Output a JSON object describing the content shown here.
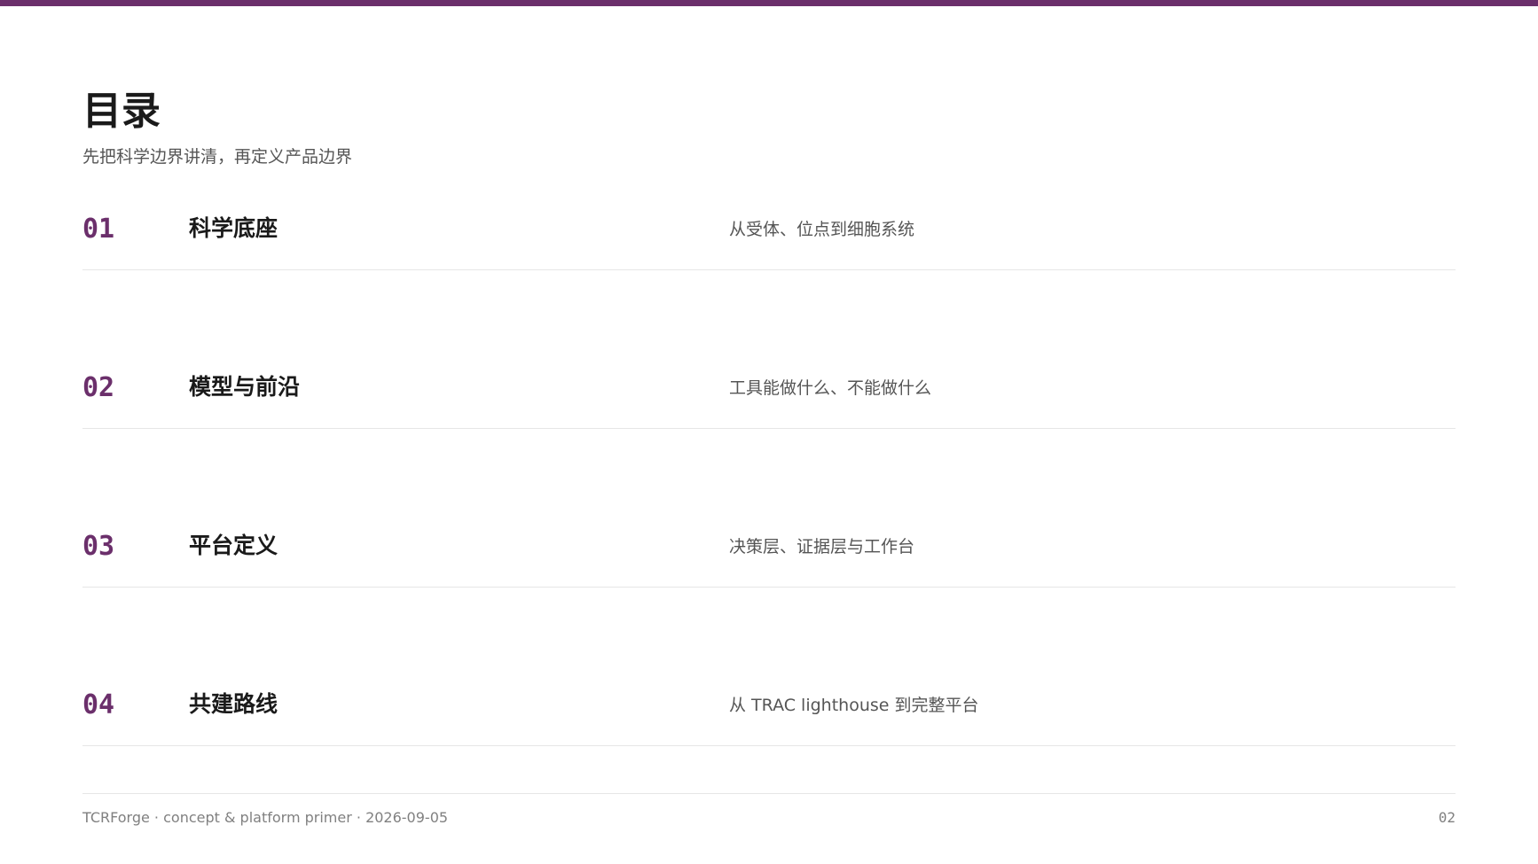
{
  "theme": {
    "accent_color": "#6b2f6b",
    "rule_color": "#e6e6e6",
    "muted_text_color": "#808080"
  },
  "slide": {
    "title": "目录",
    "subtitle": "先把科学边界讲清，再定义产品边界"
  },
  "toc": [
    {
      "number": "01",
      "heading": "科学底座",
      "description": "从受体、位点到细胞系统"
    },
    {
      "number": "02",
      "heading": "模型与前沿",
      "description": "工具能做什么、不能做什么"
    },
    {
      "number": "03",
      "heading": "平台定义",
      "description": "决策层、证据层与工作台"
    },
    {
      "number": "04",
      "heading": "共建路线",
      "description": "从 TRAC lighthouse 到完整平台"
    }
  ],
  "footer": {
    "left": "TCRForge · concept & platform primer · 2026-09-05",
    "page_number": "02"
  }
}
